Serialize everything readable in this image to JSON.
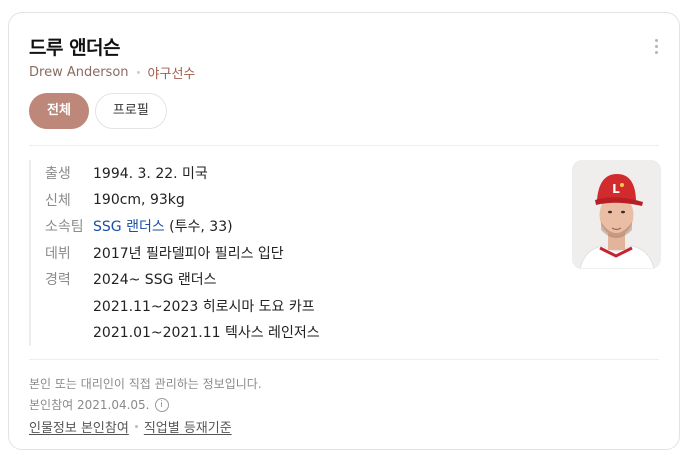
{
  "header": {
    "title": "드루 앤더슨",
    "name_en": "Drew Anderson",
    "occupation": "야구선수",
    "more_icon": "more-vertical-icon"
  },
  "tabs": [
    {
      "label": "전체",
      "active": true
    },
    {
      "label": "프로필",
      "active": false
    }
  ],
  "profile": {
    "birth": {
      "label": "출생",
      "value": "1994. 3. 22. 미국"
    },
    "body": {
      "label": "신체",
      "value": "190cm, 93kg"
    },
    "team": {
      "label": "소속팀",
      "team_link": "SSG 랜더스",
      "detail": "(투수, 33)"
    },
    "debut": {
      "label": "데뷔",
      "value": "2017년 필라델피아 필리스 입단"
    },
    "career": {
      "label": "경력",
      "items": [
        "2024~ SSG 랜더스",
        "2021.11~2023 히로시마 도요 카프",
        "2021.01~2021.11 텍사스 레인저스"
      ]
    }
  },
  "footer": {
    "notice": "본인 또는 대리인이 직접 관리하는 정보입니다.",
    "registered": "본인참여 2021.04.05.",
    "info_icon": "info-icon",
    "links": [
      "인물정보 본인참여",
      "직업별 등재기준"
    ]
  },
  "colors": {
    "accent": "#bd8779",
    "link": "#1a4ea8",
    "subtitle": "#8a6b5f",
    "occupation": "#a15c4c"
  }
}
